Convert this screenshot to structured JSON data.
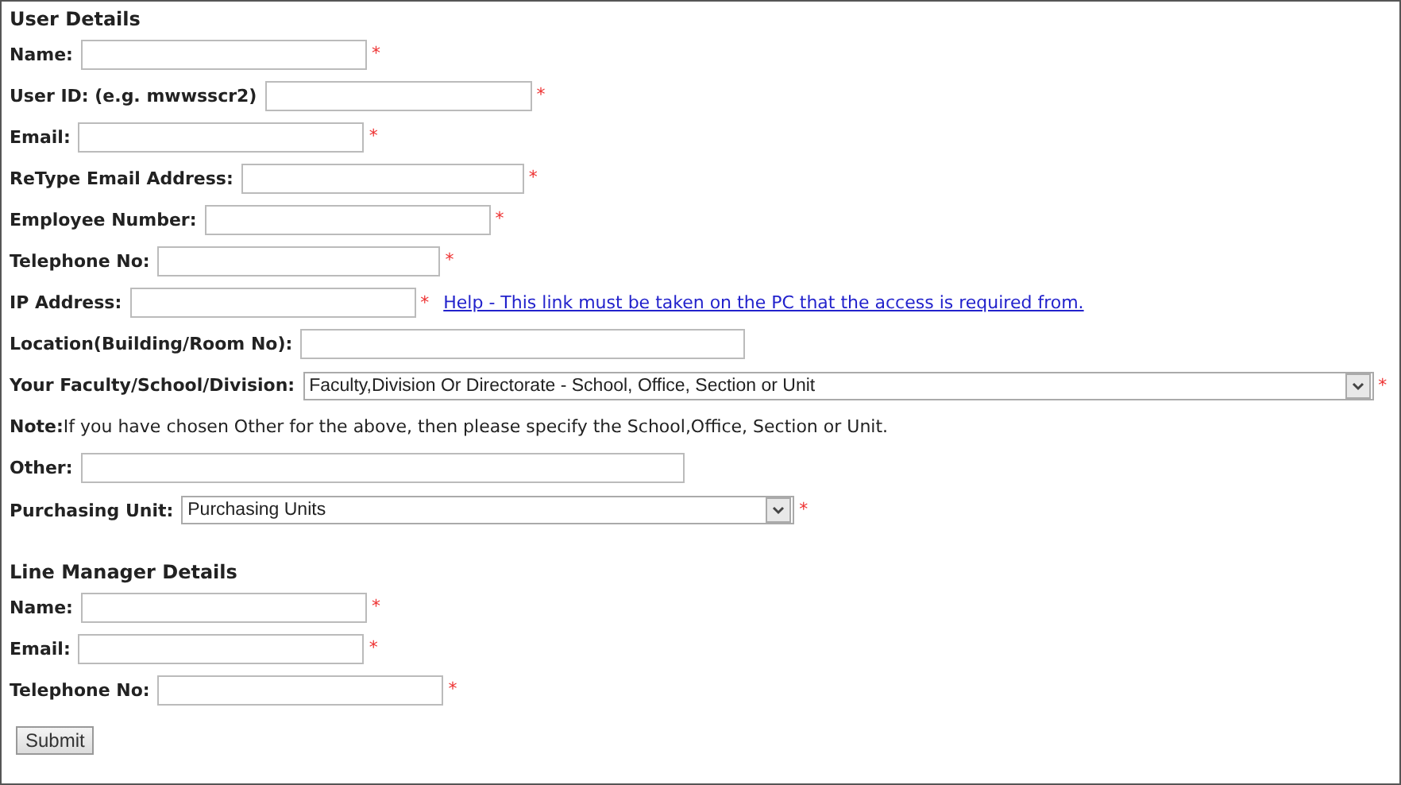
{
  "required_mark": "*",
  "sections": [
    {
      "title": "User Details",
      "fields": [
        {
          "kind": "text",
          "label": "Name:",
          "required": true
        },
        {
          "kind": "text",
          "label": "User ID: (e.g. mwwsscr2)",
          "required": true
        },
        {
          "kind": "text",
          "label": "Email:",
          "required": true
        },
        {
          "kind": "text",
          "label": "ReType Email Address:",
          "required": true
        },
        {
          "kind": "text",
          "label": "Employee Number:",
          "required": true
        },
        {
          "kind": "text",
          "label": "Telephone No:",
          "required": true
        },
        {
          "kind": "text",
          "label": "IP Address:",
          "required": true,
          "link": "Help - This link must be taken on the PC that the access is required from."
        },
        {
          "kind": "text",
          "label": "Location(Building/Room No):",
          "required": false
        },
        {
          "kind": "select",
          "label": "Your Faculty/School/Division:",
          "required": true,
          "value": "Faculty,Division Or Directorate - School, Office, Section or Unit"
        },
        {
          "kind": "note",
          "text": "**Note:**If you have chosen Other for the above, then please specify the School,Office, Section or Unit."
        },
        {
          "kind": "text",
          "label": "Other:",
          "required": false
        },
        {
          "kind": "select",
          "label": "Purchasing Unit:",
          "required": true,
          "value": "Purchasing Units"
        }
      ]
    },
    {
      "title": "Line Manager Details",
      "fields": [
        {
          "kind": "text",
          "label": "Name:",
          "required": true
        },
        {
          "kind": "text",
          "label": "Email:",
          "required": true
        },
        {
          "kind": "text",
          "label": "Telephone No:",
          "required": true
        }
      ]
    }
  ],
  "submit": "Submit"
}
